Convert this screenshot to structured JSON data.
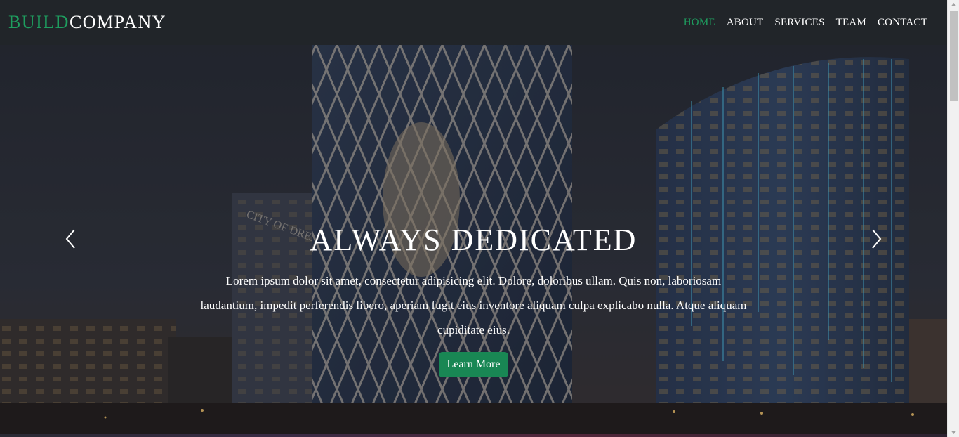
{
  "brand": {
    "part1": "BUILD",
    "part2": "COMPANY"
  },
  "nav": {
    "items": [
      {
        "label": "HOME"
      },
      {
        "label": "ABOUT"
      },
      {
        "label": "SERVICES"
      },
      {
        "label": "TEAM"
      },
      {
        "label": "CONTACT"
      }
    ],
    "active_index": 0
  },
  "hero": {
    "title": "ALWAYS DEDICATED",
    "text": "Lorem ipsum dolor sit amet, consectetur adipisicing elit. Dolore, doloribus ullam. Quis non, laboriosam laudantium, impedit perferendis libero, aperiam fugit eius inventore aliquam culpa explicabo nulla. Atque aliquam cupiditate eius.",
    "button_label": "Learn More",
    "prev_icon": "chevron-left-icon",
    "next_icon": "chevron-right-icon",
    "building_sign": "CITY OF DREAMS"
  },
  "colors": {
    "accent": "#198754",
    "brand_accent": "#1e9e5f",
    "navbar_bg": "#212529"
  }
}
